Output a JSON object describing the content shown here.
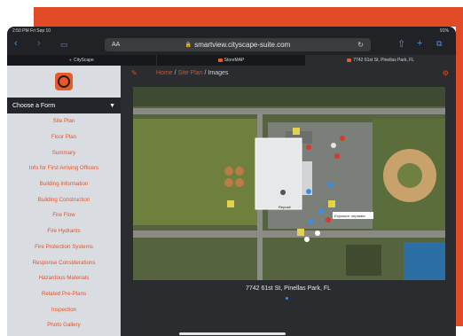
{
  "colors": {
    "accent": "#e04a24",
    "sidebar_bg": "#d9dce0",
    "menu_text": "#e4542a",
    "dark": "#202226"
  },
  "status": {
    "time": "2:50 PM  Fri Sep 10",
    "battery": "91%"
  },
  "browser": {
    "aa_label": "AA",
    "url": "smartview.cityscape-suite.com",
    "icons": [
      "back-icon",
      "forward-icon",
      "book-icon",
      "lock-icon",
      "reload-icon",
      "share-icon",
      "add-tab-icon",
      "tabs-icon"
    ]
  },
  "tabs": [
    {
      "label": "CityScape"
    },
    {
      "label": "StoreMAP"
    },
    {
      "label": "7742 61st St, Pinellas Park, FL"
    }
  ],
  "sidebar": {
    "choose_label": "Choose a Form",
    "items": [
      "Site Plan",
      "Floor Plan",
      "Summary",
      "Info for First Arriving Officers",
      "Building Information",
      "Building Construction",
      "Fire Flow",
      "Fire Hydrants",
      "Fire Protection Systems",
      "Response Considerations",
      "Hazardous Materials",
      "Related Pre-Plans",
      "Inspection",
      "Photo Gallery"
    ]
  },
  "breadcrumb": {
    "home": "Home",
    "sep": "/",
    "site_plan": "Site Plan",
    "current": "Images"
  },
  "map": {
    "marker_label": "Reposit",
    "callout": "Exposure: separate"
  },
  "address": "7742 61st St, Pinellas Park, FL"
}
